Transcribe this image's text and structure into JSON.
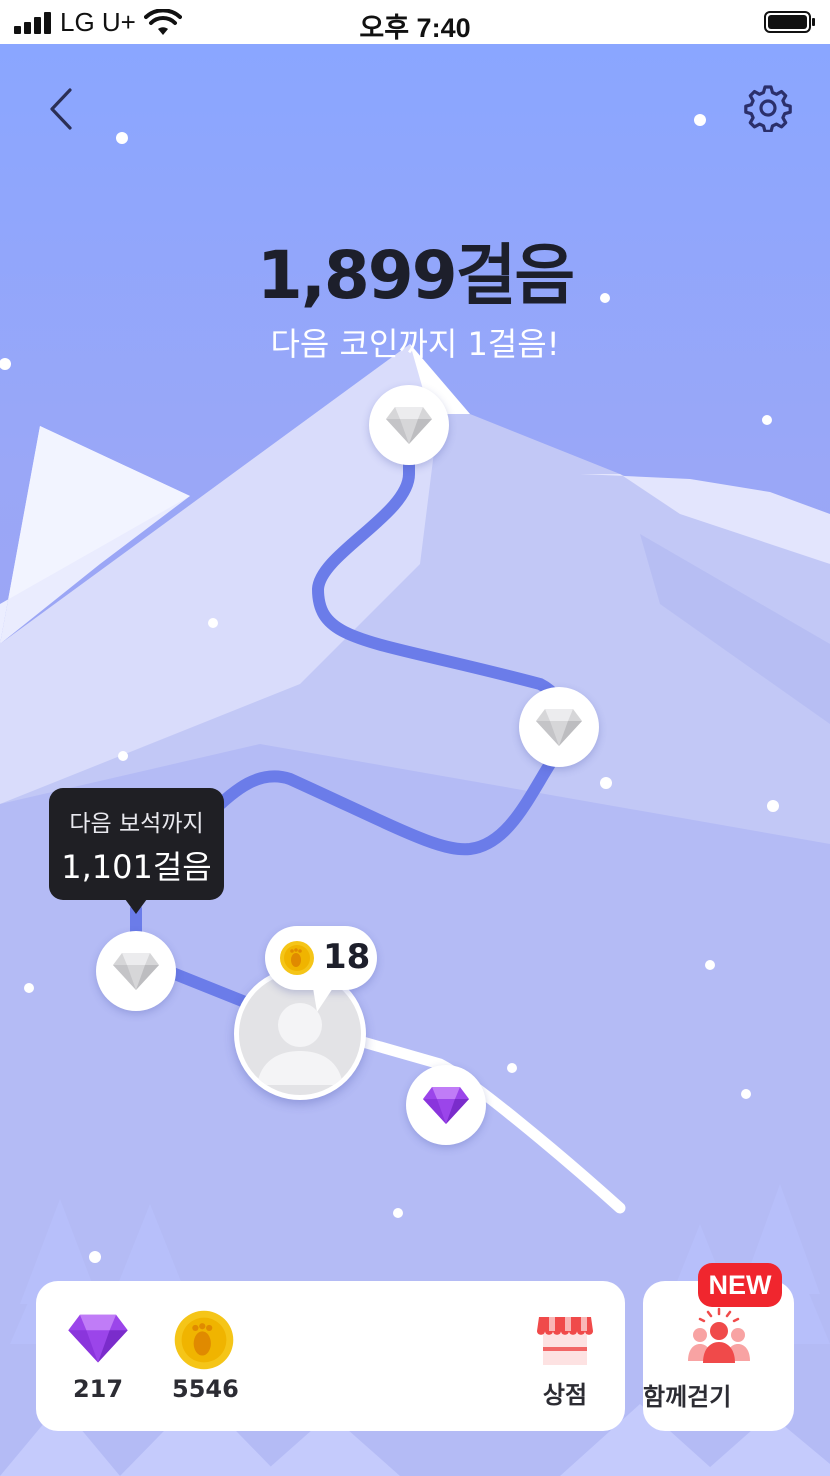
{
  "status_bar": {
    "carrier": "LG U+",
    "time": "오후 7:40"
  },
  "steps": {
    "count": "1,899걸음",
    "next_coin": "다음 코인까지 1걸음!"
  },
  "tooltip": {
    "line1": "다음 보석까지",
    "line2": "1,101걸음"
  },
  "avatar": {
    "coin_count": "18"
  },
  "wallet": {
    "gems": "217",
    "coins": "5546",
    "shop_label": "상점"
  },
  "together": {
    "label": "함께걷기",
    "badge": "NEW"
  },
  "colors": {
    "path_done": "#6b7ce9",
    "gem_active": "#9b45ea",
    "badge": "#f0262e",
    "coin": "#f5c518"
  },
  "icons": [
    "back-icon",
    "gear-icon",
    "diamond-icon",
    "coin-icon",
    "shop-icon",
    "group-icon",
    "person-icon"
  ]
}
